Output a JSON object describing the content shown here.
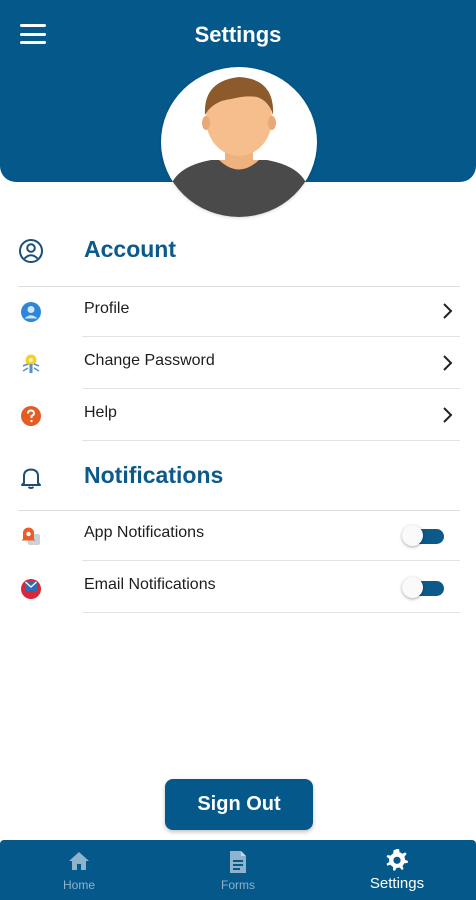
{
  "header": {
    "title": "Settings",
    "bg_color": "#05588a"
  },
  "sections": {
    "account": {
      "title": "Account",
      "icon": "user-circle-icon",
      "items": [
        {
          "label": "Profile",
          "icon": "person-icon"
        },
        {
          "label": "Change Password",
          "icon": "key-icon"
        },
        {
          "label": "Help",
          "icon": "question-icon"
        }
      ]
    },
    "notifications": {
      "title": "Notifications",
      "icon": "bell-icon",
      "items": [
        {
          "label": "App Notifications",
          "icon": "app-notification-icon",
          "enabled": true
        },
        {
          "label": "Email Notifications",
          "icon": "email-notification-icon",
          "enabled": true
        }
      ]
    }
  },
  "signout": {
    "label": "Sign Out"
  },
  "bottom_nav": {
    "items": [
      {
        "label": "Home",
        "icon": "home-icon",
        "active": false
      },
      {
        "label": "Forms",
        "icon": "forms-icon",
        "active": false
      },
      {
        "label": "Settings",
        "icon": "gear-icon",
        "active": true
      }
    ]
  }
}
